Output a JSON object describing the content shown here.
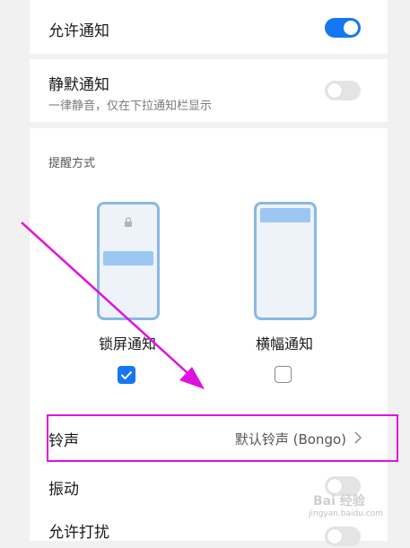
{
  "allow_notifications": {
    "label": "允许通知",
    "enabled": true
  },
  "silent_notifications": {
    "label": "静默通知",
    "description": "一律静音，仅在下拉通知栏显示",
    "enabled": false
  },
  "reminder": {
    "section_label": "提醒方式",
    "options": [
      {
        "label": "锁屏通知",
        "checked": true
      },
      {
        "label": "横幅通知",
        "checked": false
      }
    ]
  },
  "ringtone": {
    "label": "铃声",
    "value": "默认铃声 (Bongo)"
  },
  "vibration": {
    "label": "振动",
    "enabled": false
  },
  "dnd": {
    "label": "允许打扰"
  },
  "watermark": {
    "brand": "Bai 经验",
    "url": "jingyan.baidu.com"
  },
  "colors": {
    "accent": "#1677f2",
    "annotation": "#e011e0"
  }
}
